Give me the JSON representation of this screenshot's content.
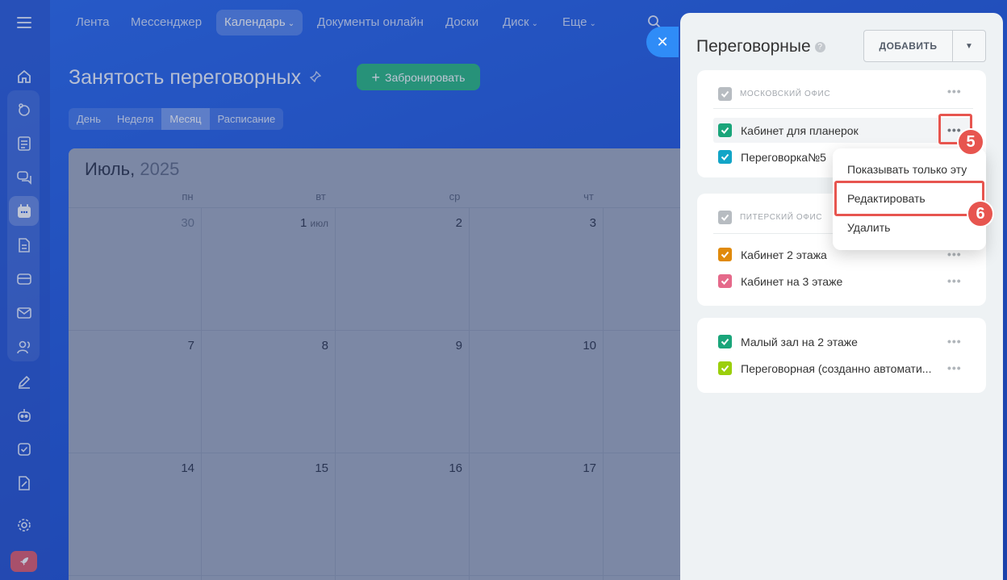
{
  "nav": {
    "items": [
      {
        "label": "Лента"
      },
      {
        "label": "Мессенджер"
      },
      {
        "label": "Календарь"
      },
      {
        "label": "Документы онлайн"
      },
      {
        "label": "Доски"
      },
      {
        "label": "Диск"
      },
      {
        "label": "Еще"
      }
    ]
  },
  "page": {
    "title": "Занятость переговорных",
    "book_button": "Забронировать",
    "view_tabs": [
      "День",
      "Неделя",
      "Месяц",
      "Расписание"
    ],
    "active_view": "Месяц"
  },
  "calendar": {
    "month": "Июль,",
    "year": "2025",
    "weekdays": [
      "пн",
      "вт",
      "ср",
      "чт"
    ],
    "weeks": [
      [
        "30",
        "1",
        "2",
        "3"
      ],
      [
        "7",
        "8",
        "9",
        "10"
      ],
      [
        "14",
        "15",
        "16",
        "17"
      ]
    ],
    "month_start_suffix": "июл"
  },
  "panel": {
    "title": "Переговорные",
    "add_button": "ДОБАВИТЬ",
    "sections": [
      {
        "header": "московский офис",
        "rooms": [
          {
            "label": "Кабинет для планерок",
            "color": "#1aa57a"
          },
          {
            "label": "Переговорка№5",
            "color": "#12a5c7"
          }
        ]
      },
      {
        "header": "питерский офис",
        "rooms": [
          {
            "label": "Кабинет 2 этажа",
            "color": "#e08a0c"
          },
          {
            "label": "Кабинет на 3 этаже",
            "color": "#e5698a"
          }
        ]
      },
      {
        "header": "",
        "rooms": [
          {
            "label": "Малый зал на 2 этаже",
            "color": "#1aa57a"
          },
          {
            "label": "Переговорная (созданно автомати...",
            "color": "#9bcf0c"
          }
        ]
      }
    ]
  },
  "context_menu": {
    "items": [
      "Показывать только эту",
      "Редактировать",
      "Удалить"
    ]
  },
  "annotations": {
    "step_5": "5",
    "step_6": "6"
  },
  "colors": {
    "accent": "#2f8cf7",
    "book_green": "#27b87f",
    "annotation_red": "#e7554f"
  }
}
